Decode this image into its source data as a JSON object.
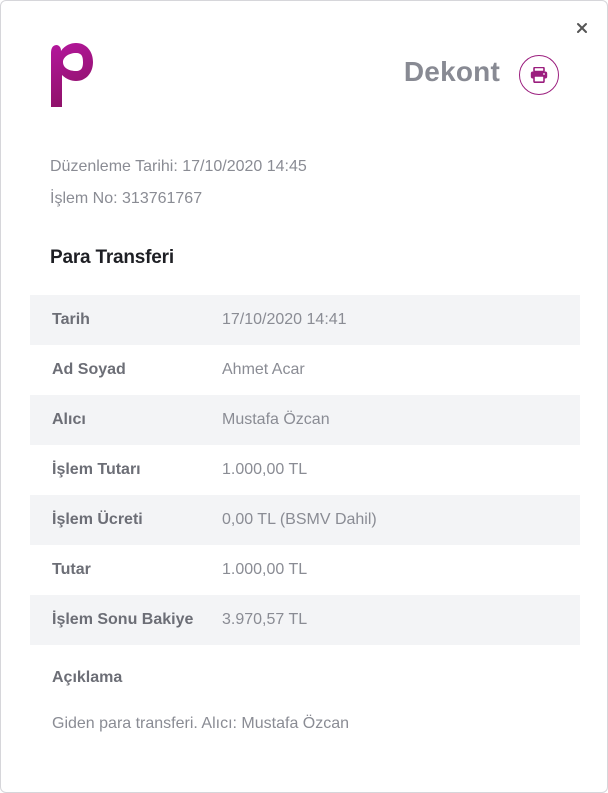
{
  "header": {
    "title": "Dekont"
  },
  "brand": {
    "accent_color": "#9b1e7e",
    "logo_icon": "p-logo-icon"
  },
  "meta": {
    "issue_date": "Düzenleme Tarihi: 17/10/2020 14:45",
    "transaction_no": "İşlem No: 313761767"
  },
  "section": {
    "title": "Para Transferi"
  },
  "details": [
    {
      "label": "Tarih",
      "value": "17/10/2020 14:41"
    },
    {
      "label": "Ad Soyad",
      "value": "Ahmet Acar"
    },
    {
      "label": "Alıcı",
      "value": "Mustafa Özcan"
    },
    {
      "label": "İşlem Tutarı",
      "value": "1.000,00 TL"
    },
    {
      "label": "İşlem Ücreti",
      "value": "0,00 TL (BSMV Dahil)"
    },
    {
      "label": "Tutar",
      "value": "1.000,00 TL"
    },
    {
      "label": "İşlem Sonu Bakiye",
      "value": "3.970,57 TL"
    }
  ],
  "description": {
    "label": "Açıklama",
    "text": "Giden para transferi. Alıcı: Mustafa Özcan"
  },
  "icons": {
    "close": "close-icon",
    "print": "printer-icon"
  }
}
